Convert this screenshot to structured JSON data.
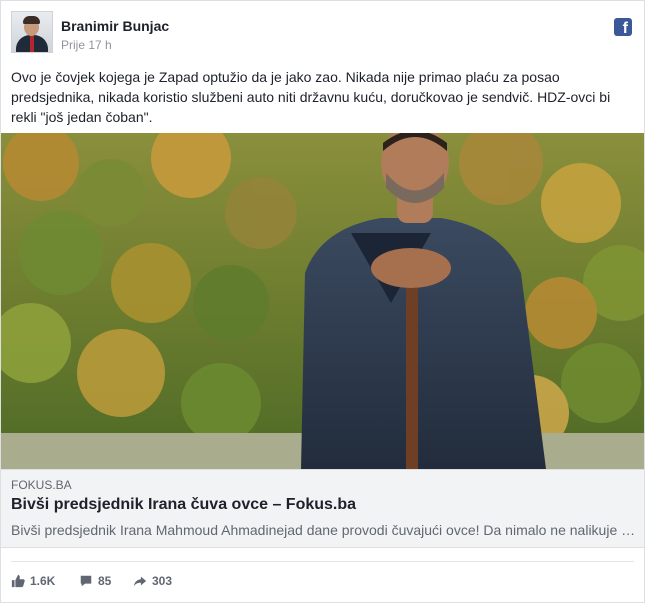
{
  "post": {
    "author": "Branimir Bunjac",
    "time": "Prije 17 h",
    "text": "Ovo je čovjek kojega je Zapad optužio da je jako zao. Nikada nije primao plaću za posao predsjednika, nikada koristio službeni auto niti državnu kuću, doručkovao je sendvič. HDZ-ovci bi rekli \"još jedan čoban\"."
  },
  "link": {
    "domain": "FOKUS.BA",
    "title": "Bivši predsjednik Irana čuva ovce – Fokus.ba",
    "description": "Bivši predsjednik Irana Mahmoud Ahmadinejad dane provodi čuvajući ovce! Da nimalo ne nalikuje na bivše predsjednike koji svoje..."
  },
  "stats": {
    "likes": "1.6K",
    "comments": "85",
    "shares": "303"
  },
  "colors": {
    "facebook_blue": "#3b5998",
    "muted_text": "#606770",
    "link_bg": "#f2f3f5"
  },
  "icons": [
    "facebook-icon",
    "like-icon",
    "comment-icon",
    "share-icon"
  ]
}
